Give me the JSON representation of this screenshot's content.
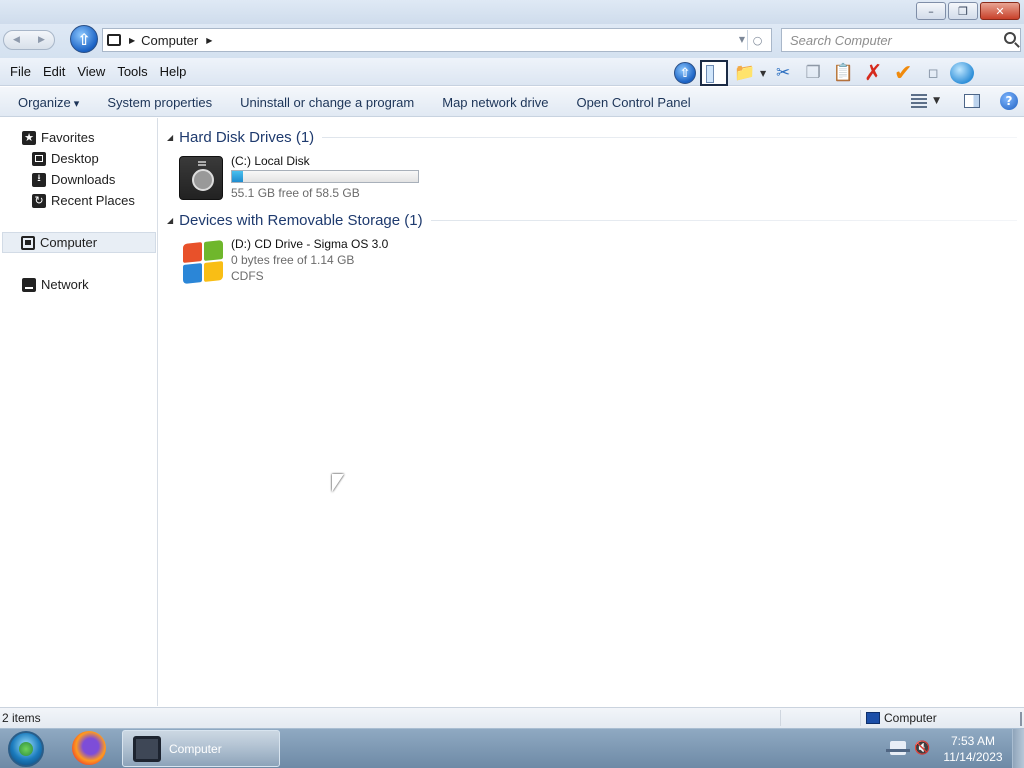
{
  "window": {
    "min_glyph": "–",
    "max_glyph": "❐",
    "close_glyph": "✕"
  },
  "address_bar": {
    "path": "Computer",
    "search_placeholder": "Search Computer"
  },
  "menu": [
    "File",
    "Edit",
    "View",
    "Tools",
    "Help"
  ],
  "command_bar": [
    "Organize",
    "System properties",
    "Uninstall or change a program",
    "Map network drive",
    "Open Control Panel"
  ],
  "nav_pane": {
    "favorites_label": "Favorites",
    "favorites": [
      "Desktop",
      "Downloads",
      "Recent Places"
    ],
    "computer_label": "Computer",
    "network_label": "Network"
  },
  "groups": {
    "hard_disk": {
      "header": "Hard Disk Drives (1)",
      "drives": [
        {
          "name": "(C:) Local Disk",
          "free_text": "55.1 GB free of 58.5 GB",
          "used_fraction": 0.058
        }
      ]
    },
    "removable": {
      "header": "Devices with Removable Storage (1)",
      "drives": [
        {
          "name": "(D:) CD Drive - Sigma OS 3.0",
          "free_text": "0 bytes free of 1.14 GB",
          "filesystem": "CDFS"
        }
      ]
    }
  },
  "status_bar": {
    "item_count": "2 items",
    "location": "Computer"
  },
  "taskbar": {
    "active_window": "Computer",
    "time": "7:53 AM",
    "date": "11/14/2023"
  },
  "colors": {
    "group_header": "#1e3a6e",
    "usage_bar": "#1f8ccf"
  }
}
